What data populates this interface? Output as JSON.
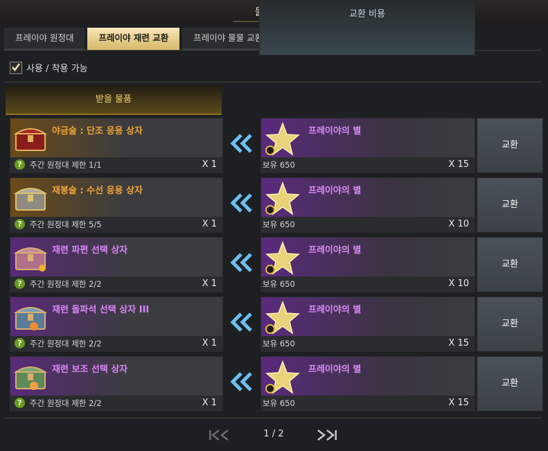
{
  "window": {
    "title": "물물교환"
  },
  "tabs": [
    {
      "label": "프레이야 원정대",
      "active": false
    },
    {
      "label": "프레이야 재련 교환",
      "active": true
    },
    {
      "label": "프레이야 물물 교환",
      "active": false
    }
  ],
  "filter": {
    "label": "사용 / 착용 가능",
    "checked": true
  },
  "columns": {
    "receive": "받을 물품",
    "cost": "교환 비용"
  },
  "rows": [
    {
      "item": {
        "name": "야금술 : 단조 응용 상자",
        "name_color": "#f0a43a",
        "icon": "red-chest-icon",
        "limit": "주간 원정대 제한 1/1",
        "qty": "X 1"
      },
      "cost": {
        "name": "프레이야의 별",
        "owned": "보유 650",
        "qty": "X 15",
        "icon": "star-icon"
      },
      "button": "교환"
    },
    {
      "item": {
        "name": "재봉술 : 수선 응용 상자",
        "name_color": "#f0a43a",
        "icon": "silver-chest-icon",
        "limit": "주간 원정대 제한 5/5",
        "qty": "X 1"
      },
      "cost": {
        "name": "프레이야의 별",
        "owned": "보유 650",
        "qty": "X 10",
        "icon": "star-icon"
      },
      "button": "교환"
    },
    {
      "item": {
        "name": "재련 파편 선택 상자",
        "name_color": "#d986f7",
        "icon": "pink-chest-icon",
        "limit": "주간 원정대 제한 2/2",
        "qty": "X 1"
      },
      "cost": {
        "name": "프레이야의 별",
        "owned": "보유 650",
        "qty": "X 10",
        "icon": "star-icon"
      },
      "button": "교환"
    },
    {
      "item": {
        "name": "재련 돌파석 선택 상자 III",
        "name_color": "#d986f7",
        "icon": "blue-chest-icon",
        "limit": "주간 원정대 제한 2/2",
        "qty": "X 1"
      },
      "cost": {
        "name": "프레이야의 별",
        "owned": "보유 650",
        "qty": "X 15",
        "icon": "star-icon"
      },
      "button": "교환"
    },
    {
      "item": {
        "name": "재련 보조 선택 상자",
        "name_color": "#d986f7",
        "icon": "green-chest-icon",
        "limit": "주간 원정대 제한 2/2",
        "qty": "X 1"
      },
      "cost": {
        "name": "프레이야의 별",
        "owned": "보유 650",
        "qty": "X 15",
        "icon": "star-icon"
      },
      "button": "교환"
    }
  ],
  "pagination": {
    "page": "1 / 2"
  },
  "colors": {
    "accent_gold": "#d9bb6e",
    "epic_purple": "#d986f7",
    "legendary_orange": "#f0a43a",
    "qmark_green": "#6c9a25"
  }
}
